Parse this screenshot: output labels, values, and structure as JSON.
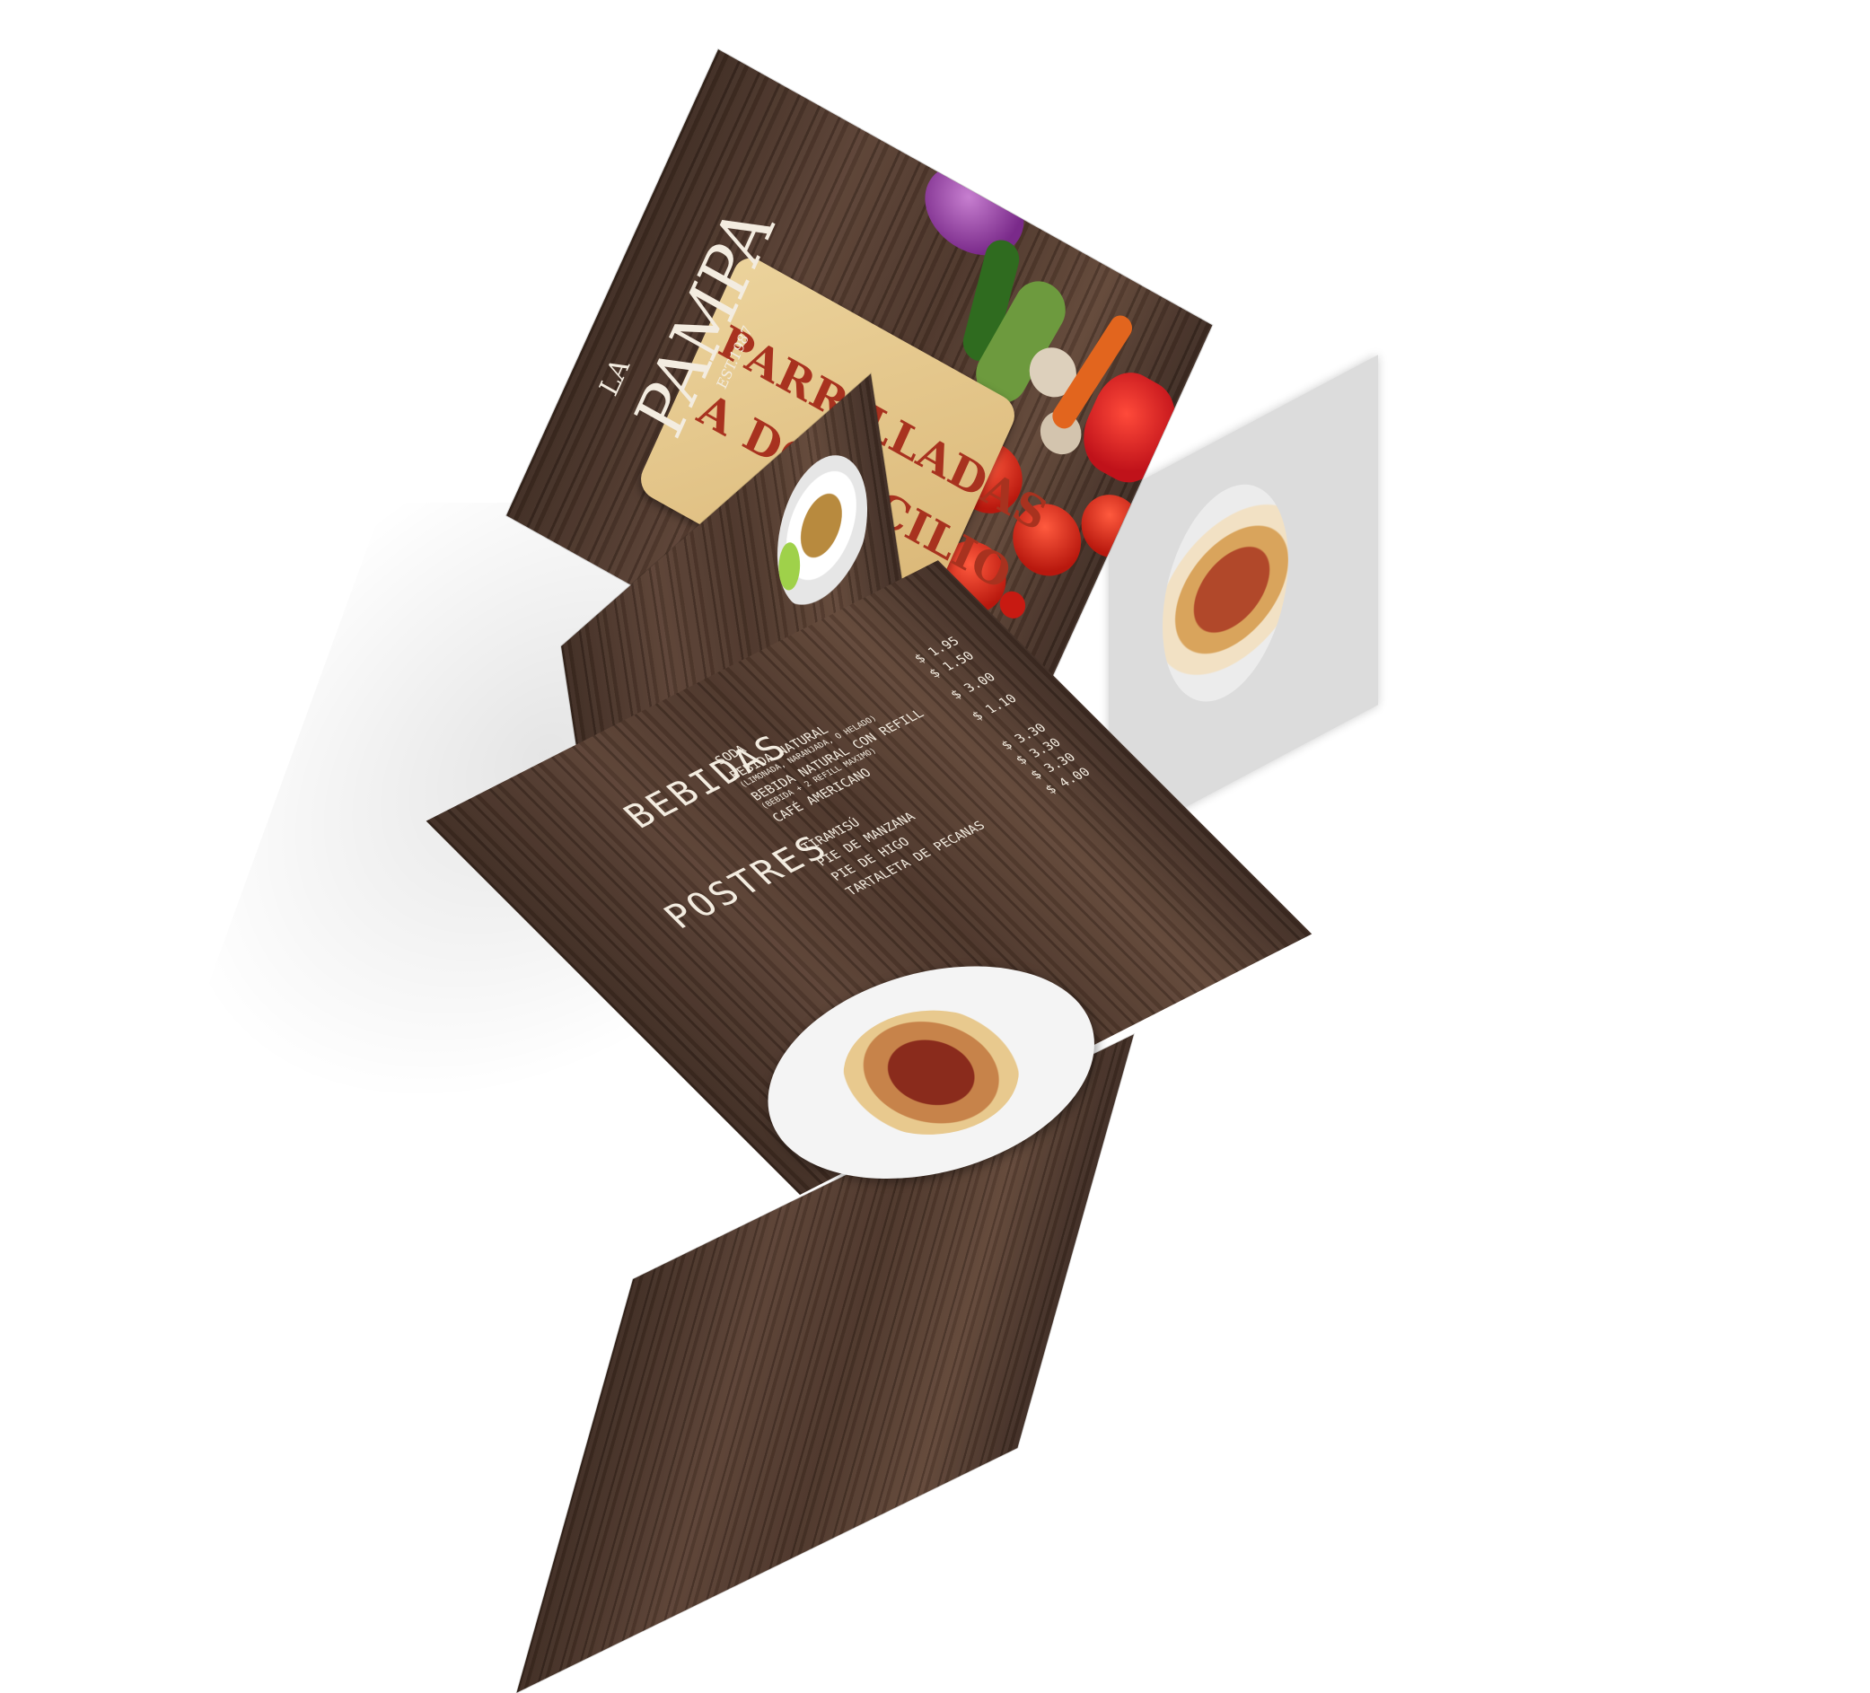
{
  "brand": {
    "article": "LA",
    "name": "PAMPA",
    "est": "EST.1987"
  },
  "cover": {
    "headline_line1": "PARRILLADAS",
    "headline_line2": "A DOMICILIO"
  },
  "menu": {
    "bebidas_title": "BEBIDAS",
    "bebidas": [
      {
        "name": "SODA",
        "note": "",
        "price": "$ 1.95"
      },
      {
        "name": "BEBIDA NATURAL",
        "note": "(LIMONADA, NARANJADA, O HELADO)",
        "price": "$ 1.50"
      },
      {
        "name": "BEBIDA NATURAL CON REFILL",
        "note": "(BEBIDA + 2 REFILL MAXIMO)",
        "price": "$ 3.00"
      },
      {
        "name": "CAFÉ AMERICANO",
        "note": "",
        "price": "$ 1.10"
      }
    ],
    "postres_title": "POSTRES",
    "postres": [
      {
        "name": "TIRAMISÚ",
        "price": "$ 3.30"
      },
      {
        "name": "PIE DE MANZANA",
        "price": "$ 3.30"
      },
      {
        "name": "PIE DE HIGO",
        "price": "$ 3.30"
      },
      {
        "name": "TARTALETA DE PECANAS",
        "price": "$ 4.00"
      }
    ]
  },
  "colors": {
    "headline": "#a8321f",
    "board": "#e6c48a",
    "chalk": "#f3ece0",
    "wood_dark": "#3d2a20"
  }
}
